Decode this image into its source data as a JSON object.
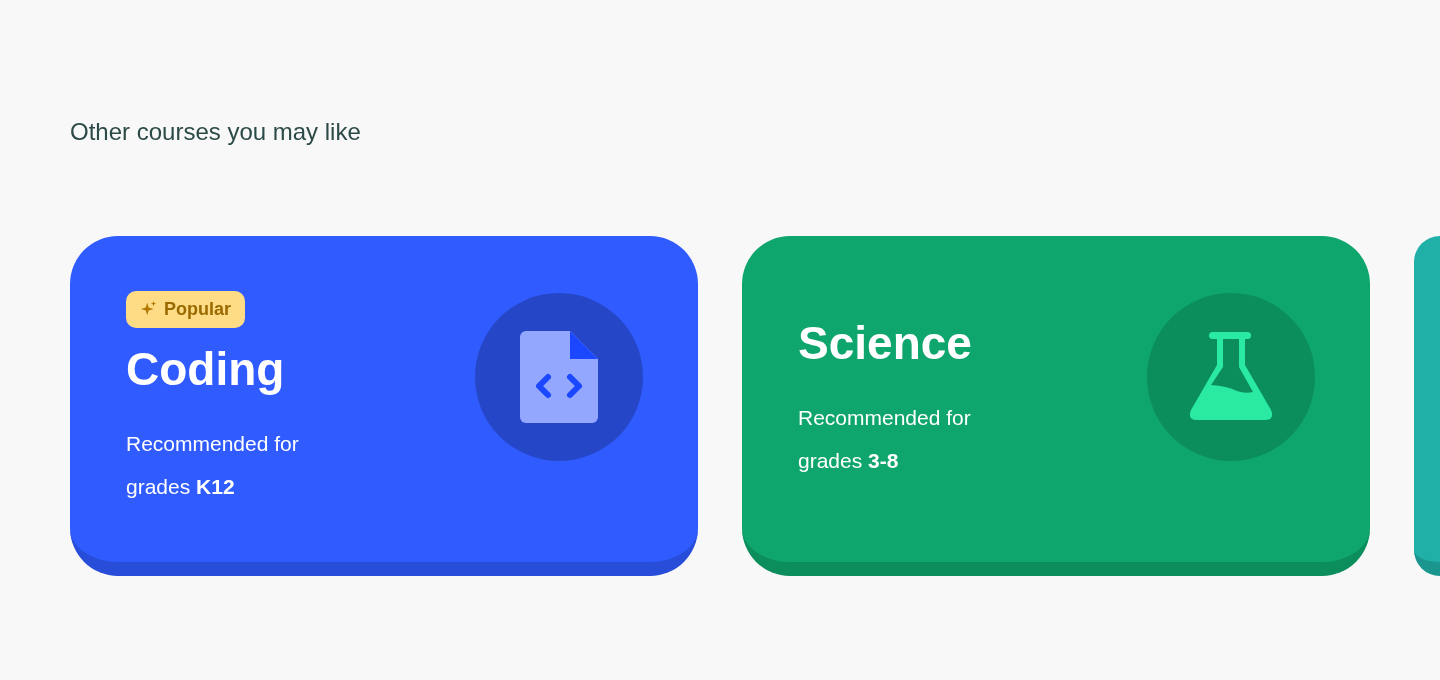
{
  "heading": "Other courses you may like",
  "courses": [
    {
      "kind": "code",
      "color": "#2f5bff",
      "badge": "Popular",
      "title": "Coding",
      "recommendation": "Recommended for grades **K12**"
    },
    {
      "kind": "flask",
      "color": "#0ea66c",
      "title": "Science",
      "recommendation": "Recommended for grades **3-8**"
    },
    {
      "kind": "partial",
      "color": "#20b0a8"
    }
  ]
}
